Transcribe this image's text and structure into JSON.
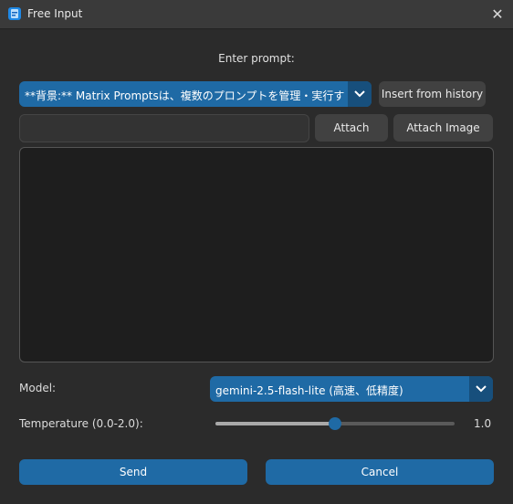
{
  "window": {
    "title": "Free Input"
  },
  "prompt": {
    "label": "Enter prompt:",
    "history_selected": "**背景:** Matrix Promptsは、複数のプロンプトを管理・実行する",
    "insert_history_label": "Insert from history"
  },
  "attach": {
    "value": "",
    "attach_label": "Attach",
    "attach_image_label": "Attach Image"
  },
  "prompt_text": "",
  "model": {
    "label": "Model:",
    "selected": "gemini-2.5-flash-lite (高速、低精度)"
  },
  "temperature": {
    "label": "Temperature (0.0-2.0):",
    "value": 1.0,
    "value_text": "1.0",
    "min": 0.0,
    "max": 2.0
  },
  "actions": {
    "send_label": "Send",
    "cancel_label": "Cancel"
  },
  "colors": {
    "accent": "#1f6aa5",
    "accent_dark": "#174f7c",
    "background": "#2b2b2b"
  }
}
